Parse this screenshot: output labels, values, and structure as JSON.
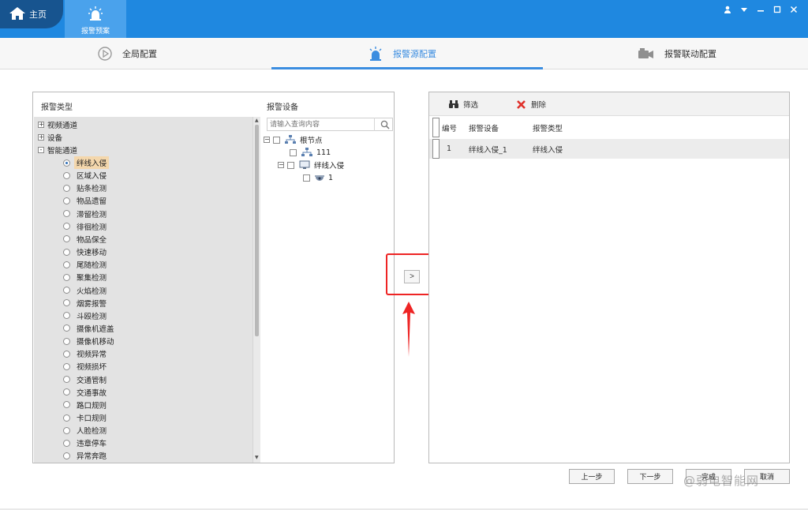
{
  "topbar": {
    "home_label": "主页",
    "alarm_plan_label": "报警预案"
  },
  "tabs": [
    {
      "label": "全局配置",
      "icon": "play-circle-icon"
    },
    {
      "label": "报警源配置",
      "icon": "alarm-light-icon",
      "active": true
    },
    {
      "label": "报警联动配置",
      "icon": "camera-icon"
    }
  ],
  "left_panel": {
    "type_header": "报警类型",
    "device_header": "报警设备",
    "search_placeholder": "请输入查询内容",
    "type_tree": [
      {
        "label": "视频通道",
        "expander": "+"
      },
      {
        "label": "设备",
        "expander": "+"
      },
      {
        "label": "智能通道",
        "expander": "-"
      }
    ],
    "smart_items": [
      "绊线入侵",
      "区域入侵",
      "贴条检测",
      "物品遗留",
      "滞留检测",
      "徘徊检测",
      "物品保全",
      "快速移动",
      "尾随检测",
      "聚集检测",
      "火焰检测",
      "烟雾报警",
      "斗殴检测",
      "摄像机遮盖",
      "摄像机移动",
      "视频异常",
      "视频损坏",
      "交通管制",
      "交通事故",
      "路口规则",
      "卡口规则",
      "人脸检测",
      "违章停车",
      "异常奔跑"
    ],
    "selected_index": 0,
    "device_tree": {
      "root": "根节点",
      "child1": "111",
      "child2": "绊线入侵",
      "grandchild": "1"
    }
  },
  "transfer_button": ">",
  "right_panel": {
    "filter_label": "筛选",
    "delete_label": "删除",
    "columns": [
      "编号",
      "报警设备",
      "报警类型"
    ],
    "rows": [
      {
        "id": "1",
        "device": "绊线入侵_1",
        "type": "绊线入侵"
      }
    ]
  },
  "buttons": {
    "prev": "上一步",
    "next": "下一步",
    "confirm": "完成",
    "cancel": "取消"
  },
  "watermark": "@弱电智能网",
  "colors": {
    "topbar": "#1f88e0",
    "home_tab": "#17548f",
    "accent": "#3b8de0",
    "selection": "#f4d7ac",
    "annotation_red": "#ee2424"
  }
}
